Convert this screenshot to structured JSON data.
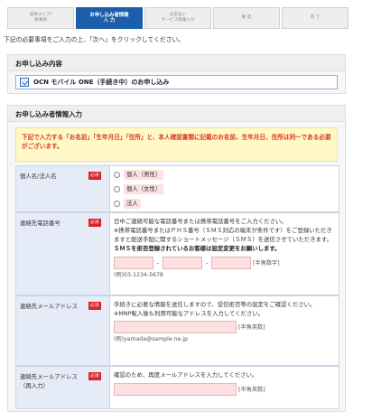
{
  "steps": [
    {
      "line1": "提供エリア/",
      "line2": "要事項"
    },
    {
      "line1": "お申し込み者情報",
      "line2": "入 力"
    },
    {
      "line1": "お支払い",
      "line2": "サービス情報入力"
    },
    {
      "line1": "確 認",
      "line2": ""
    },
    {
      "line1": "完 了",
      "line2": ""
    }
  ],
  "intro": "下記の必要事項をご入力の上、「次へ」をクリックしてください。",
  "plan_section": {
    "title": "お申し込み内容",
    "plan": "OCN モバイル ONE（手続き中）のお申し込み"
  },
  "form_section": {
    "title": "お申し込み者情報入力",
    "notice": "下記で入力する「お名前」「生年月日」「住所」と、本人確認書類に記載のお名前、生年月日、住所は同一である必要がございます。",
    "required": "必須",
    "type": {
      "label": "個人名/法人名",
      "options": [
        "個人（男性）",
        "個人（女性）",
        "法人"
      ]
    },
    "phone": {
      "label": "連絡先電話番号",
      "desc1": "日中ご連絡可能な電話番号または携帯電話番号をご入力ください。",
      "desc2": "※携帯電話番号またはＰＨＳ番号（ＳＭＳ対応の端末が条件です）をご登録いただきますと配送手配に関するショートメッセージ（ＳＭＳ）を送信させていただきます。",
      "desc_bold": "ＳＭＳを拒否登録されているお客様は設定変更をお願いします。",
      "hyphen": "-",
      "hint": "[半角数字]",
      "example": "(例)03-1234-5678"
    },
    "email": {
      "label": "連絡先メールアドレス",
      "desc1": "手続きに必要な情報を送信しますので、受信拒否等の設定をご確認ください。",
      "desc2": "※MNP転入後も利用可能なアドレスを入力してください。",
      "hint": "[半角英数]",
      "example": "(例)yamada@sample.ne.jp"
    },
    "email_confirm": {
      "label": "連絡先メールアドレス",
      "label2": "（再入力）",
      "desc": "確認のため、再度メールアドレスを入力してください。",
      "hint": "[半角英数]"
    }
  }
}
